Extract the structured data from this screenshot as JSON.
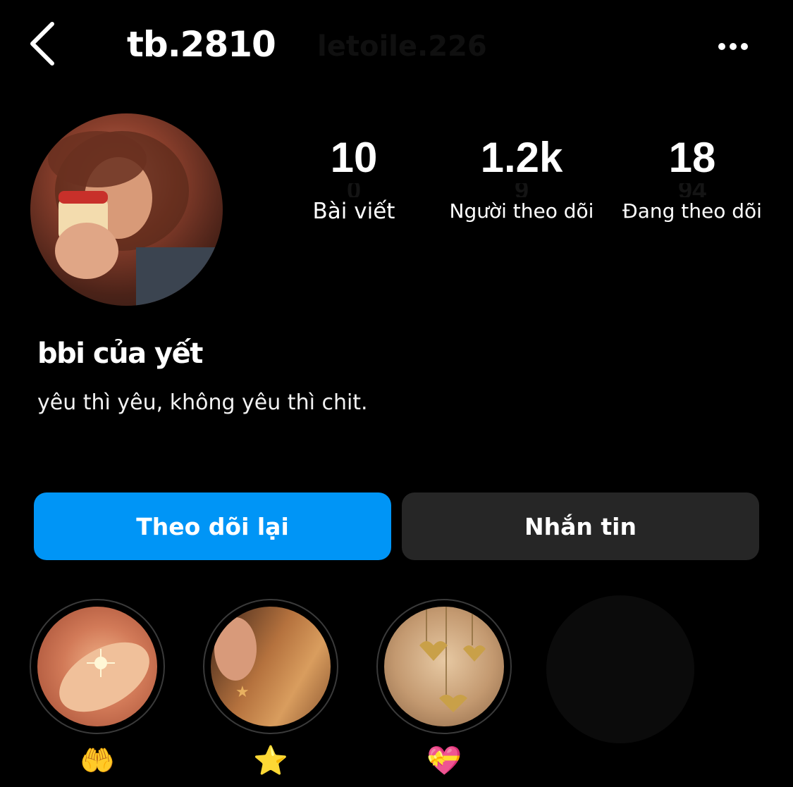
{
  "header": {
    "username": "tb.2810",
    "ghost_username": "letoile.226",
    "back_icon": "chevron-left-icon",
    "more_icon": "more-horizontal-icon"
  },
  "profile": {
    "display_name": "bbi của yết",
    "bio": "yêu thì yêu, không yêu thì chit."
  },
  "stats": [
    {
      "count": "10",
      "ghost": "0",
      "label": "Bài viết"
    },
    {
      "count": "1.2k",
      "ghost": "9",
      "label": "Người theo dõi"
    },
    {
      "count": "18",
      "ghost": "94",
      "label": "Đang theo dõi"
    }
  ],
  "buttons": {
    "follow_back": "Theo dõi lại",
    "message": "Nhắn tin"
  },
  "highlights": [
    {
      "label": "🤲"
    },
    {
      "label": "⭐"
    },
    {
      "label": "💝"
    }
  ],
  "colors": {
    "accent": "#0095f6",
    "secondary_button": "#262626",
    "background": "#000000"
  }
}
